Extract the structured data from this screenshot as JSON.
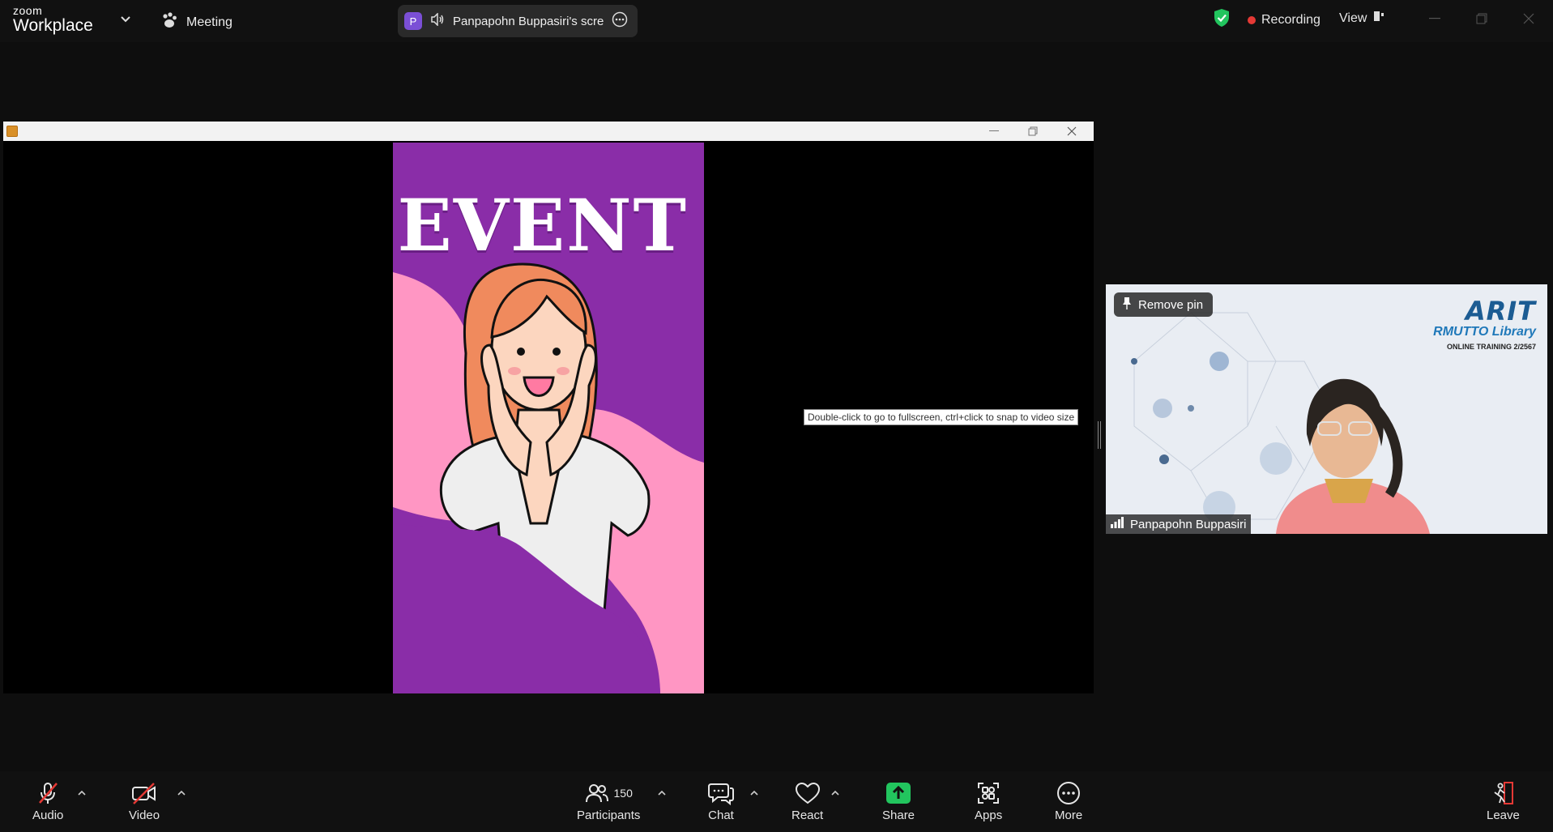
{
  "topbar": {
    "logo_small": "zoom",
    "logo_large": "Workplace",
    "meeting_label": "Meeting",
    "share_avatar_initial": "P",
    "share_name": "Panpapohn Buppasiri's screen",
    "recording_label": "Recording",
    "view_label": "View"
  },
  "shared_screen": {
    "poster_title": "EVENT",
    "tooltip": "Double-click to go to fullscreen, ctrl+click to snap to video size"
  },
  "video_tile": {
    "remove_pin_label": "Remove pin",
    "brand_title": "ARIT",
    "brand_subtitle": "RMUTTO Library",
    "brand_training": "ONLINE TRAINING 2/2567",
    "participant_name": "Panpapohn Buppasiri"
  },
  "toolbar": {
    "audio_label": "Audio",
    "video_label": "Video",
    "participants_label": "Participants",
    "participants_count": "150",
    "chat_label": "Chat",
    "react_label": "React",
    "share_label": "Share",
    "apps_label": "Apps",
    "more_label": "More",
    "leave_label": "Leave"
  },
  "colors": {
    "poster_purple": "#8a2da8",
    "poster_pink": "#ff96c3",
    "share_green": "#22c55e",
    "recording_red": "#e53935",
    "shield_green": "#22c55e"
  }
}
